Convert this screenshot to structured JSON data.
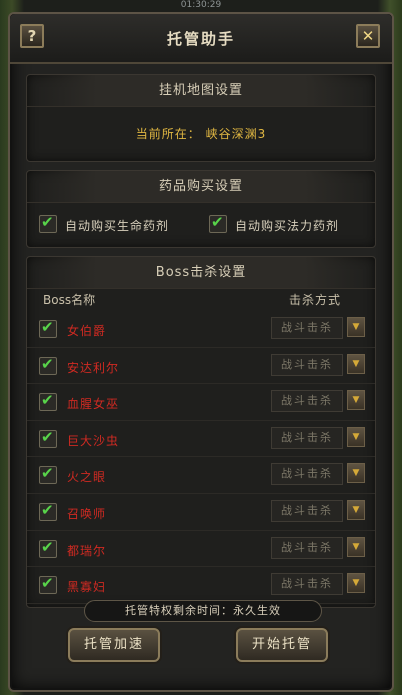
{
  "status_bar": {
    "clock": "01:30:29"
  },
  "window": {
    "title": "托管助手",
    "help_glyph": "?",
    "close_glyph": "✕"
  },
  "map_section": {
    "header": "挂机地图设置",
    "current_label": "当前所在：",
    "current_map": "峡谷深渊3"
  },
  "potion_section": {
    "header": "药品购买设置",
    "options": [
      {
        "label": "自动购买生命药剂",
        "checked": true
      },
      {
        "label": "自动购买法力药剂",
        "checked": true
      }
    ]
  },
  "boss_section": {
    "header": "Boss击杀设置",
    "col_name": "Boss名称",
    "col_mode": "击杀方式",
    "rows": [
      {
        "name": "女伯爵",
        "mode": "战斗击杀",
        "checked": true
      },
      {
        "name": "安达利尔",
        "mode": "战斗击杀",
        "checked": true
      },
      {
        "name": "血腥女巫",
        "mode": "战斗击杀",
        "checked": true
      },
      {
        "name": "巨大沙虫",
        "mode": "战斗击杀",
        "checked": true
      },
      {
        "name": "火之眼",
        "mode": "战斗击杀",
        "checked": true
      },
      {
        "name": "召唤师",
        "mode": "战斗击杀",
        "checked": true
      },
      {
        "name": "都瑞尔",
        "mode": "战斗击杀",
        "checked": true
      },
      {
        "name": "黑寡妇",
        "mode": "战斗击杀",
        "checked": true
      }
    ]
  },
  "vip": {
    "text": "托管特权剩余时间：永久生效"
  },
  "buttons": {
    "speed": "托管加速",
    "start": "开始托管"
  },
  "colors": {
    "boss_name": "#cf2a22",
    "map_text": "#e0b742",
    "check": "#58d34a"
  }
}
